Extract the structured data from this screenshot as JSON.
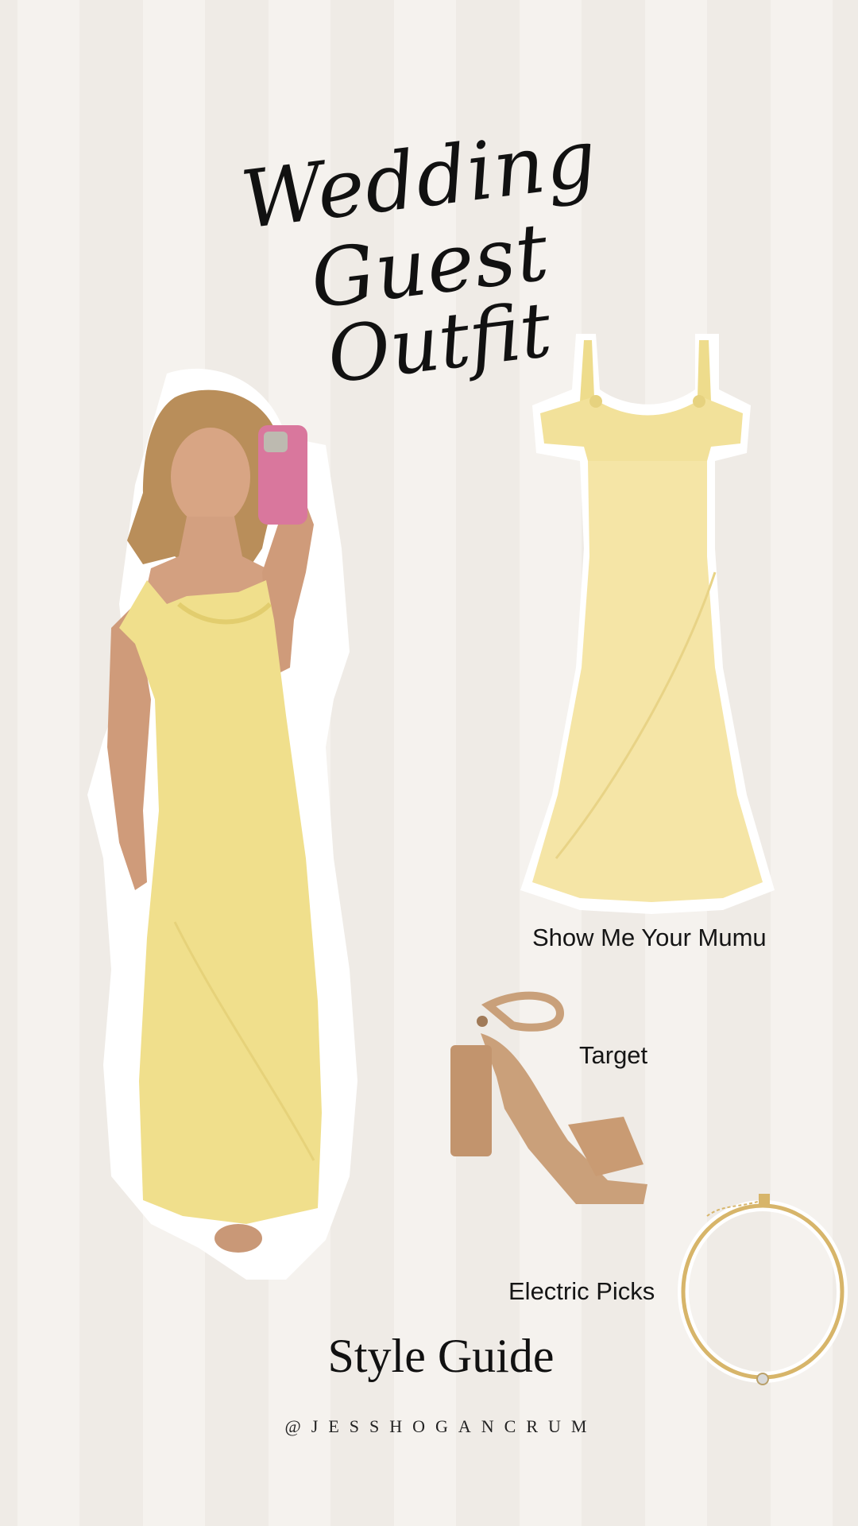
{
  "title": {
    "line1": "Wedding Guest",
    "line2": "Outfit"
  },
  "products": {
    "dress_brand": "Show Me Your Mumu",
    "shoes_brand": "Target",
    "necklace_brand": "Electric Picks"
  },
  "footer": {
    "heading": "Style Guide",
    "handle": "@JESSHOGANCRUM"
  },
  "colors": {
    "dress": "#f3e39a",
    "shoes": "#caa07a",
    "necklace": "#d7b56a",
    "phone": "#d9779d"
  },
  "icons": [
    "mirror-selfie-photo",
    "yellow-slip-dress",
    "tan-heel-sandal",
    "gold-necklace"
  ]
}
